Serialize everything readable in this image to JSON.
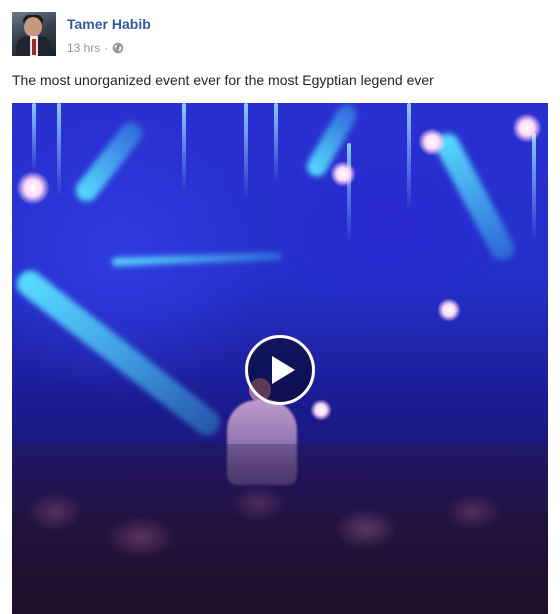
{
  "post": {
    "author": "Tamer Habib",
    "timestamp": "13 hrs",
    "separator": "·",
    "privacy_icon": "globe-icon",
    "text": "The most unorganized event ever for the most Egyptian legend ever"
  },
  "video": {
    "play_icon": "play-icon"
  },
  "colors": {
    "author_link": "#365899",
    "meta_text": "#90949c",
    "body_text": "#1d2129"
  }
}
